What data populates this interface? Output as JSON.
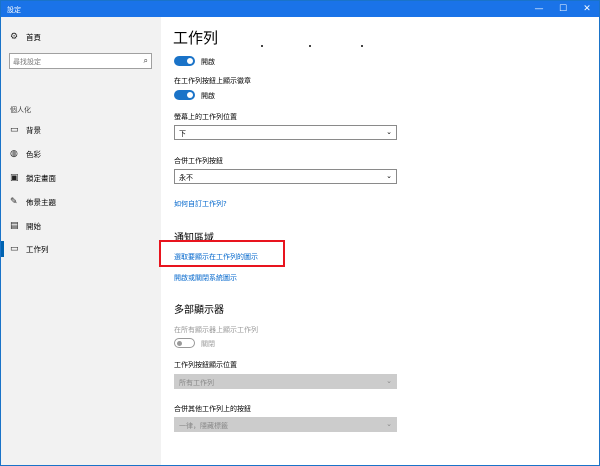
{
  "window": {
    "title": "設定",
    "min": "—",
    "max": "☐",
    "close": "✕"
  },
  "sidebar": {
    "home": {
      "icon": "gear-icon",
      "glyph": "⚙",
      "label": "首頁"
    },
    "search": {
      "placeholder": "尋找設定",
      "icon": "search-icon",
      "glyph": "⌕"
    },
    "section": "個人化",
    "items": [
      {
        "name": "background",
        "icon": "image-icon",
        "glyph": "▭",
        "label": "背景"
      },
      {
        "name": "colors",
        "icon": "palette-icon",
        "glyph": "◍",
        "label": "色彩"
      },
      {
        "name": "lockscreen",
        "icon": "monitor-icon",
        "glyph": "▣",
        "label": "鎖定畫面"
      },
      {
        "name": "themes",
        "icon": "brush-icon",
        "glyph": "✎",
        "label": "佈景主題"
      },
      {
        "name": "start",
        "icon": "start-icon",
        "glyph": "▤",
        "label": "開始"
      },
      {
        "name": "taskbar",
        "icon": "taskbar-icon",
        "glyph": "▭",
        "label": "工作列"
      }
    ]
  },
  "main": {
    "title": "工作列",
    "toggle1": {
      "state": "開啟"
    },
    "badges": {
      "label": "在工作列按鈕上顯示徽章",
      "state": "開啟"
    },
    "position": {
      "label": "螢幕上的工作列位置",
      "value": "下",
      "chev": "⌄"
    },
    "combine": {
      "label": "合併工作列按鈕",
      "value": "永不",
      "chev": "⌄"
    },
    "customize_link": "如何自訂工作列?",
    "notification": {
      "heading": "通知區域",
      "link1": "選取要顯示在工作列的圖示",
      "link2": "開啟或關閉系統圖示"
    },
    "multi": {
      "heading": "多部顯示器",
      "show_all_label": "在所有顯示器上顯示工作列",
      "show_all_state": "關閉",
      "buttons_label": "工作列按鈕顯示位置",
      "buttons_value": "所有工作列",
      "combine_other_label": "合併其他工作列上的按鈕",
      "combine_other_value": "一律，隱藏標籤",
      "chev": "⌄"
    }
  }
}
